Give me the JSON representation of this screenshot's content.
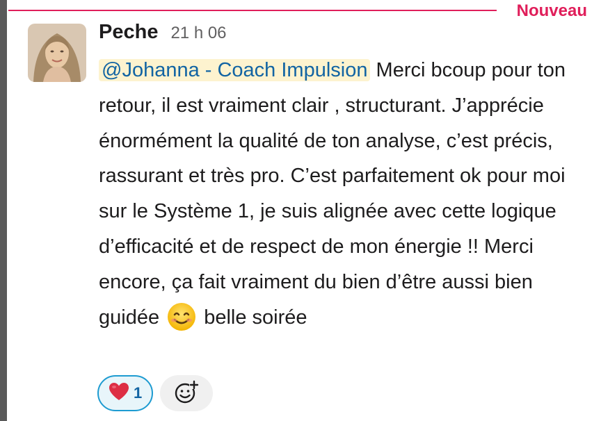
{
  "divider": {
    "label": "Nouveau",
    "color": "#e01e5a"
  },
  "message": {
    "author": "Peche",
    "time": "21 h 06",
    "mention": "@Johanna - Coach Impulsion",
    "text_part1": " Merci bcoup pour ton retour, il est vraiment clair , structurant. J’apprécie énormément la qualité de ton analyse, c’est précis, rassurant et très pro. C’est parfaitement ok pour moi sur le Système 1, je suis alignée avec cette logique d’efficacité et de respect de mon énergie !! Merci encore, ça fait vraiment du bien d’être aussi bien guidée ",
    "inline_emoji": "smiling-face-icon",
    "text_part2": " belle soirée"
  },
  "reactions": [
    {
      "emoji": "red-heart-icon",
      "count": "1",
      "active": true
    }
  ],
  "add_reaction_icon": "add-emoji-icon",
  "colors": {
    "mention_bg": "#fdf3cf",
    "mention_text": "#1264a3",
    "reaction_border": "#1d9bd1"
  }
}
